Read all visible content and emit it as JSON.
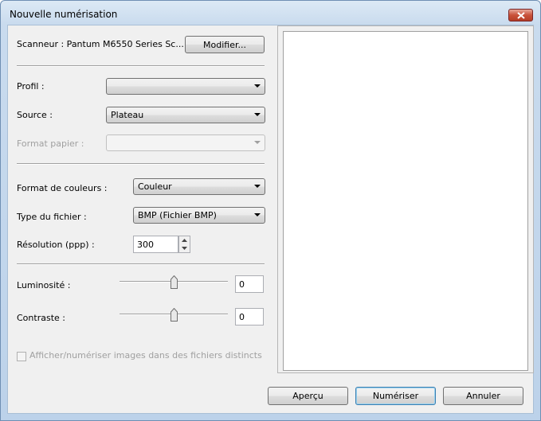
{
  "window": {
    "title": "Nouvelle numérisation",
    "close_icon": "close-icon"
  },
  "scanner": {
    "label": "Scanneur : Pantum M6550 Series Sc...",
    "modify_button": "Modifier..."
  },
  "profile": {
    "label": "Profil :",
    "value": ""
  },
  "source": {
    "label": "Source :",
    "value": "Plateau"
  },
  "paper_format": {
    "label": "Format papier :",
    "value": ""
  },
  "color_format": {
    "label": "Format de couleurs :",
    "value": "Couleur"
  },
  "file_type": {
    "label": "Type du fichier :",
    "value": "BMP (Fichier BMP)"
  },
  "resolution": {
    "label": "Résolution (ppp) :",
    "value": "300"
  },
  "brightness": {
    "label": "Luminosité :",
    "value": "0",
    "level": 0.5
  },
  "contrast": {
    "label": "Contraste :",
    "value": "0",
    "level": 0.5
  },
  "separate_files": {
    "label": "Afficher/numériser images dans des fichiers distincts",
    "checked": false,
    "enabled": false
  },
  "buttons": {
    "preview": "Aperçu",
    "scan": "Numériser",
    "cancel": "Annuler"
  },
  "colors": {
    "title_bar": "#c9dbee",
    "client_bg": "#f0f0f0",
    "close_button": "#c9523a",
    "default_button_border": "#3c7fb1"
  }
}
